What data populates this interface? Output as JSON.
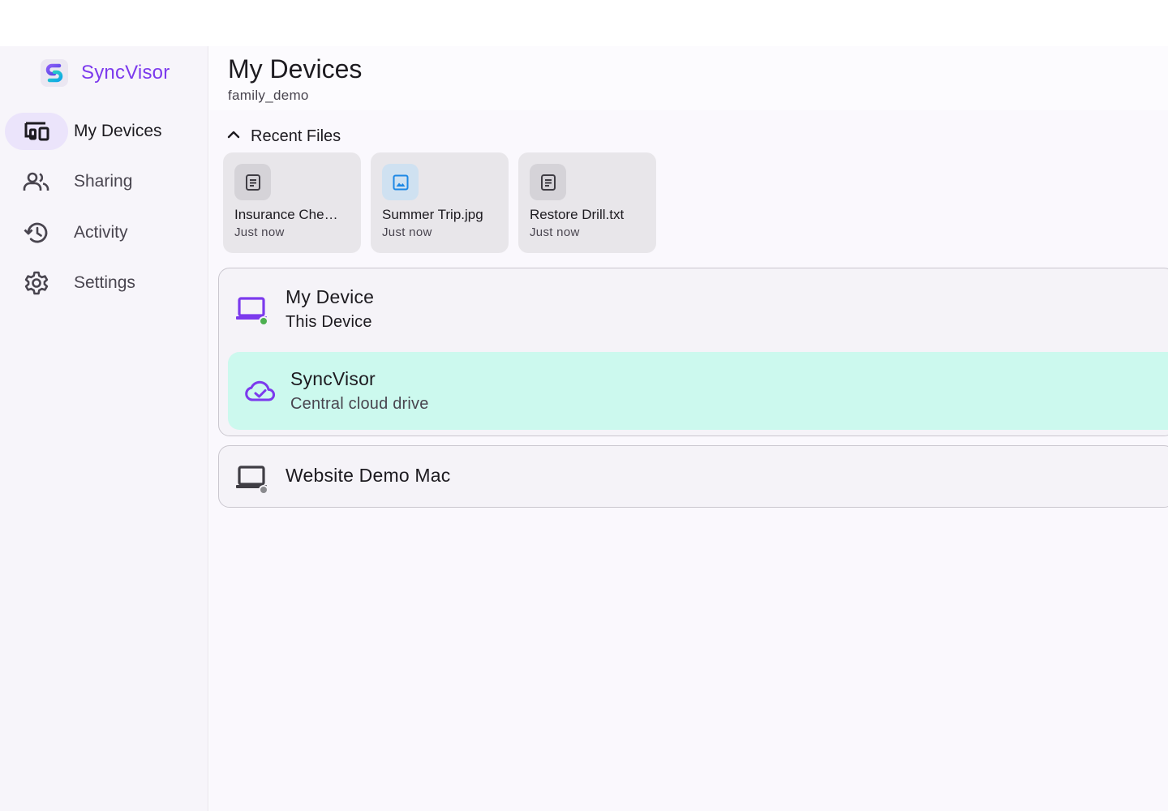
{
  "app": {
    "name": "SyncVisor",
    "logo_icon": "syncvisor-logo",
    "accent_color": "#7c3aed"
  },
  "sidebar": {
    "items": [
      {
        "label": "My Devices",
        "icon": "devices-icon",
        "active": true
      },
      {
        "label": "Sharing",
        "icon": "people-icon",
        "active": false
      },
      {
        "label": "Activity",
        "icon": "history-icon",
        "active": false
      },
      {
        "label": "Settings",
        "icon": "gear-icon",
        "active": false
      }
    ]
  },
  "header": {
    "title": "My Devices",
    "subtitle": "family_demo"
  },
  "recent": {
    "label": "Recent Files",
    "expanded": true,
    "files": [
      {
        "name": "Insurance Che…",
        "time": "Just now",
        "icon": "document-icon"
      },
      {
        "name": "Summer Trip.jpg",
        "time": "Just now",
        "icon": "image-icon"
      },
      {
        "name": "Restore Drill.txt",
        "time": "Just now",
        "icon": "document-icon"
      }
    ]
  },
  "devices": {
    "this_device": {
      "name": "My Device",
      "subtitle": "This Device",
      "icon": "laptop-icon",
      "status_color": "#4caf50"
    },
    "cloud": {
      "name": "SyncVisor",
      "subtitle": "Central cloud drive",
      "icon": "cloud-check-icon",
      "highlight_color": "#ccf9ee"
    },
    "other": {
      "name": "Website Demo Mac",
      "icon": "laptop-icon",
      "status_color": "#8a8a8e"
    }
  }
}
